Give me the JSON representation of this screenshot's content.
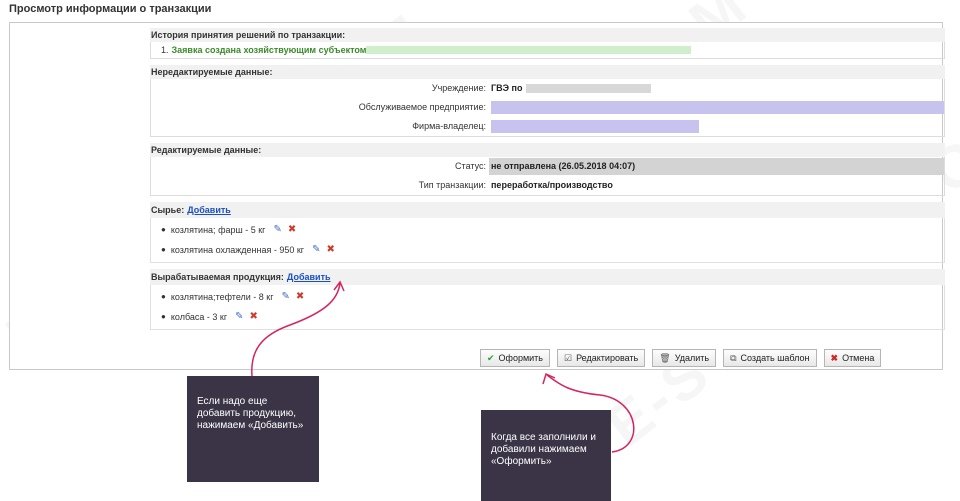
{
  "page_title": "Просмотр информации о транзакции",
  "history": {
    "title": "История принятия решений по транзакции:",
    "items": [
      {
        "num": "1.",
        "text": "Заявка создана хозяйствующим субъектом :"
      }
    ]
  },
  "readonly": {
    "title": "Нередактируемые данные:",
    "rows": [
      {
        "label": "Учреждение:",
        "value": "ГВЭ по"
      },
      {
        "label": "Обслуживаемое предприятие:",
        "value": ""
      },
      {
        "label": "Фирма-владелец:",
        "value": ""
      }
    ]
  },
  "editable": {
    "title": "Редактируемые данные:",
    "rows": [
      {
        "label": "Статус:",
        "value": "не отправлена (26.05.2018 04:07)"
      },
      {
        "label": "Тип транзакции:",
        "value": "переработка/производство"
      }
    ]
  },
  "raw": {
    "title": "Сырье:",
    "add_label": "Добавить",
    "items": [
      "козлятина; фарш - 5 кг",
      "козлятина охлажденная - 950 кг"
    ]
  },
  "products": {
    "title": "Вырабатываемая продукция:",
    "add_label": "Добавить",
    "items": [
      "козлятина;тефтели - 8 кг",
      "колбаса - 3 кг"
    ]
  },
  "buttons": {
    "submit": "Оформить",
    "edit": "Редактировать",
    "delete": "Удалить",
    "template": "Создать шаблон",
    "cancel": "Отмена"
  },
  "callouts": {
    "add_hint": "Если надо еще добавить продукцию, нажимаем «Добавить»",
    "submit_hint": "Когда все заполнили и добавили нажимаем «Оформить»"
  },
  "watermark": "E-STRANA.COM",
  "colors": {
    "accent_link": "#1a4fc2",
    "callout_bg": "#3a3446",
    "arrow": "#d6245f",
    "history_green": "#3a8b2a"
  },
  "icons": {
    "submit": "check-icon",
    "edit": "edit-icon",
    "delete": "trash-icon",
    "template": "copy-icon",
    "cancel": "close-icon",
    "row_edit": "pencil-icon",
    "row_delete": "cross-icon"
  }
}
